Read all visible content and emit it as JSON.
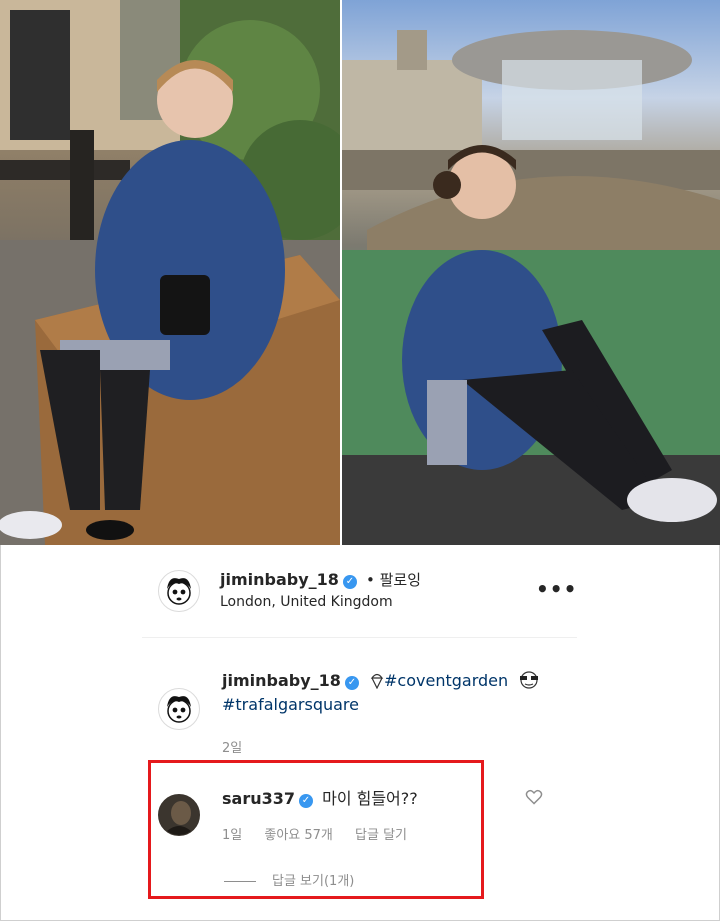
{
  "photos": {
    "left": {
      "icon": "photo-covent-garden"
    },
    "right": {
      "icon": "photo-trafalgar-fountain"
    }
  },
  "post": {
    "username": "jiminbaby_18",
    "follow_label": "• 팔로잉",
    "location": "London, United Kingdom",
    "more_icon": "more-horizontal-icon",
    "more_label": "•••"
  },
  "caption": {
    "username": "jiminbaby_18",
    "hashtag1": "#coventgarden",
    "hashtag2": "#trafalgarsquare",
    "time": "2일",
    "emoji_icons": [
      "ice-cream-emoji-icon",
      "sunglasses-emoji-icon"
    ]
  },
  "comment": {
    "username": "saru337",
    "text": "마이 힘들어??",
    "time": "1일",
    "likes": "좋아요 57개",
    "reply": "답글 달기",
    "view_replies": "답글 보기(1개)",
    "like_icon": "heart-outline-icon"
  },
  "colors": {
    "verified": "#3897f0",
    "hashtag": "#003569",
    "highlight": "#e5191c",
    "meta_text": "#8e8e8e"
  }
}
